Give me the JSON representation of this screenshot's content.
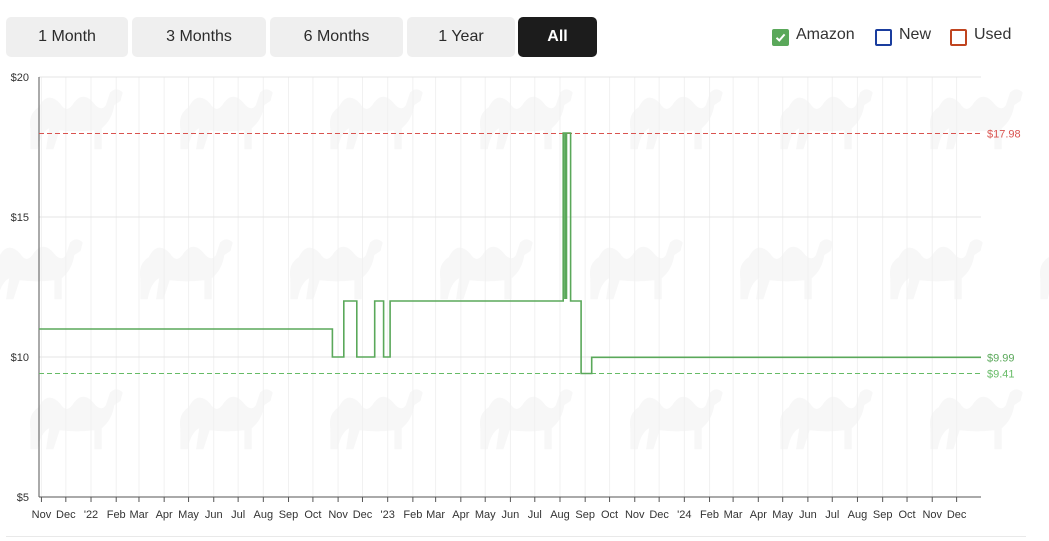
{
  "range_tabs": [
    {
      "label": "1 Month",
      "active": false
    },
    {
      "label": "3 Months",
      "active": false
    },
    {
      "label": "6 Months",
      "active": false
    },
    {
      "label": "1 Year",
      "active": false
    },
    {
      "label": "All",
      "active": true
    }
  ],
  "legend": [
    {
      "label": "Amazon",
      "color": "#5aa85a",
      "checked": true
    },
    {
      "label": "New",
      "color": "#1a3d9e",
      "checked": false
    },
    {
      "label": "Used",
      "color": "#c0441f",
      "checked": false
    }
  ],
  "watermark_icon": "camel-icon",
  "chart_data": {
    "type": "line",
    "step": true,
    "xlabel": "",
    "ylabel": "",
    "ylim": [
      5,
      20
    ],
    "y_ticks": [
      {
        "value": 5,
        "label": "$5"
      },
      {
        "value": 10,
        "label": "$10"
      },
      {
        "value": 15,
        "label": "$15"
      },
      {
        "value": 20,
        "label": "$20"
      }
    ],
    "x_range": [
      "2021-10-29",
      "2024-12-31"
    ],
    "x_ticks": [
      {
        "date": "2021-11-01",
        "label": "Nov"
      },
      {
        "date": "2021-12-01",
        "label": "Dec"
      },
      {
        "date": "2022-01-01",
        "label": "'22"
      },
      {
        "date": "2022-02-01",
        "label": "Feb"
      },
      {
        "date": "2022-03-01",
        "label": "Mar"
      },
      {
        "date": "2022-04-01",
        "label": "Apr"
      },
      {
        "date": "2022-05-01",
        "label": "May"
      },
      {
        "date": "2022-06-01",
        "label": "Jun"
      },
      {
        "date": "2022-07-01",
        "label": "Jul"
      },
      {
        "date": "2022-08-01",
        "label": "Aug"
      },
      {
        "date": "2022-09-01",
        "label": "Sep"
      },
      {
        "date": "2022-10-01",
        "label": "Oct"
      },
      {
        "date": "2022-11-01",
        "label": "Nov"
      },
      {
        "date": "2022-12-01",
        "label": "Dec"
      },
      {
        "date": "2023-01-01",
        "label": "'23"
      },
      {
        "date": "2023-02-01",
        "label": "Feb"
      },
      {
        "date": "2023-03-01",
        "label": "Mar"
      },
      {
        "date": "2023-04-01",
        "label": "Apr"
      },
      {
        "date": "2023-05-01",
        "label": "May"
      },
      {
        "date": "2023-06-01",
        "label": "Jun"
      },
      {
        "date": "2023-07-01",
        "label": "Jul"
      },
      {
        "date": "2023-08-01",
        "label": "Aug"
      },
      {
        "date": "2023-09-01",
        "label": "Sep"
      },
      {
        "date": "2023-10-01",
        "label": "Oct"
      },
      {
        "date": "2023-11-01",
        "label": "Nov"
      },
      {
        "date": "2023-12-01",
        "label": "Dec"
      },
      {
        "date": "2024-01-01",
        "label": "'24"
      },
      {
        "date": "2024-02-01",
        "label": "Feb"
      },
      {
        "date": "2024-03-01",
        "label": "Mar"
      },
      {
        "date": "2024-04-01",
        "label": "Apr"
      },
      {
        "date": "2024-05-01",
        "label": "May"
      },
      {
        "date": "2024-06-01",
        "label": "Jun"
      },
      {
        "date": "2024-07-01",
        "label": "Jul"
      },
      {
        "date": "2024-08-01",
        "label": "Aug"
      },
      {
        "date": "2024-09-01",
        "label": "Sep"
      },
      {
        "date": "2024-10-01",
        "label": "Oct"
      },
      {
        "date": "2024-11-01",
        "label": "Nov"
      },
      {
        "date": "2024-12-01",
        "label": "Dec"
      }
    ],
    "series": [
      {
        "name": "Amazon",
        "color": "#5aa85a",
        "points": [
          [
            "2021-10-29",
            11.0
          ],
          [
            "2022-10-25",
            10.0
          ],
          [
            "2022-11-08",
            12.0
          ],
          [
            "2022-11-24",
            10.0
          ],
          [
            "2022-12-16",
            12.0
          ],
          [
            "2022-12-27",
            10.0
          ],
          [
            "2023-01-04",
            12.0
          ],
          [
            "2023-08-05",
            18.0
          ],
          [
            "2023-08-07",
            12.1
          ],
          [
            "2023-08-09",
            18.0
          ],
          [
            "2023-08-14",
            12.0
          ],
          [
            "2023-08-27",
            9.41
          ],
          [
            "2023-09-09",
            9.99
          ],
          [
            "2024-12-31",
            9.99
          ]
        ]
      }
    ],
    "reference_lines": [
      {
        "name": "highest",
        "value": 17.98,
        "label": "$17.98",
        "color": "#d9534f"
      },
      {
        "name": "current",
        "value": 9.99,
        "label": "$9.99",
        "color": "#5aa85a"
      },
      {
        "name": "lowest",
        "value": 9.41,
        "label": "$9.41",
        "color": "#66bb66"
      }
    ]
  }
}
